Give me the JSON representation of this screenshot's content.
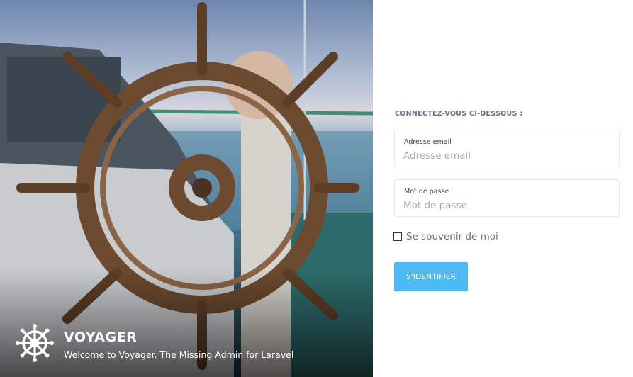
{
  "hero": {
    "brand_title": "VOYAGER",
    "brand_subtitle": "Welcome to Voyager. The Missing Admin for Laravel",
    "logo_icon": "ship-wheel-icon",
    "photo": "ship-helm-wheel-photo"
  },
  "login": {
    "heading": "CONNECTEZ-VOUS CI-DESSOUS :",
    "email": {
      "label": "Adresse email",
      "placeholder": "Adresse email",
      "value": ""
    },
    "password": {
      "label": "Mot de passe",
      "placeholder": "Mot de passe",
      "value": ""
    },
    "remember": {
      "label": "Se souvenir de moi",
      "checked": false
    },
    "submit_label": "S'IDENTIFIER"
  },
  "colors": {
    "accent": "#4fbaf2",
    "panel_bg": "#ffffff",
    "border": "#e4eaec"
  }
}
